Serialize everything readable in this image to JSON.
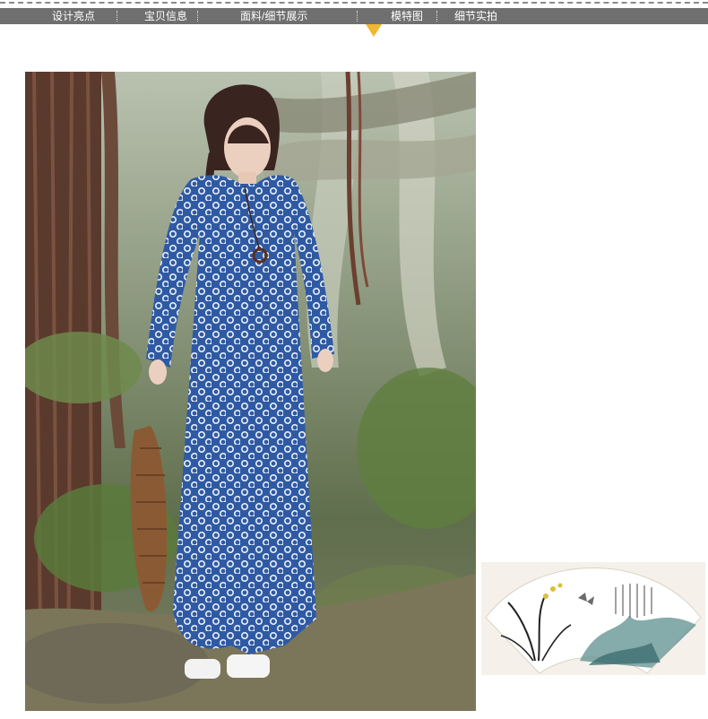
{
  "nav": {
    "items": [
      {
        "label": "设计亮点"
      },
      {
        "label": "宝贝信息"
      },
      {
        "label": "面料/细节展示"
      },
      {
        "label": "模特图"
      },
      {
        "label": "细节实拍"
      }
    ],
    "active_index": 3,
    "bar_color": "#6f6f6f",
    "marker_color": "#f0b733"
  },
  "photo": {
    "subject": "model-in-forest",
    "dress_color": "#2f5aa3"
  },
  "fan": {
    "icon": "folding-fan-painting"
  }
}
